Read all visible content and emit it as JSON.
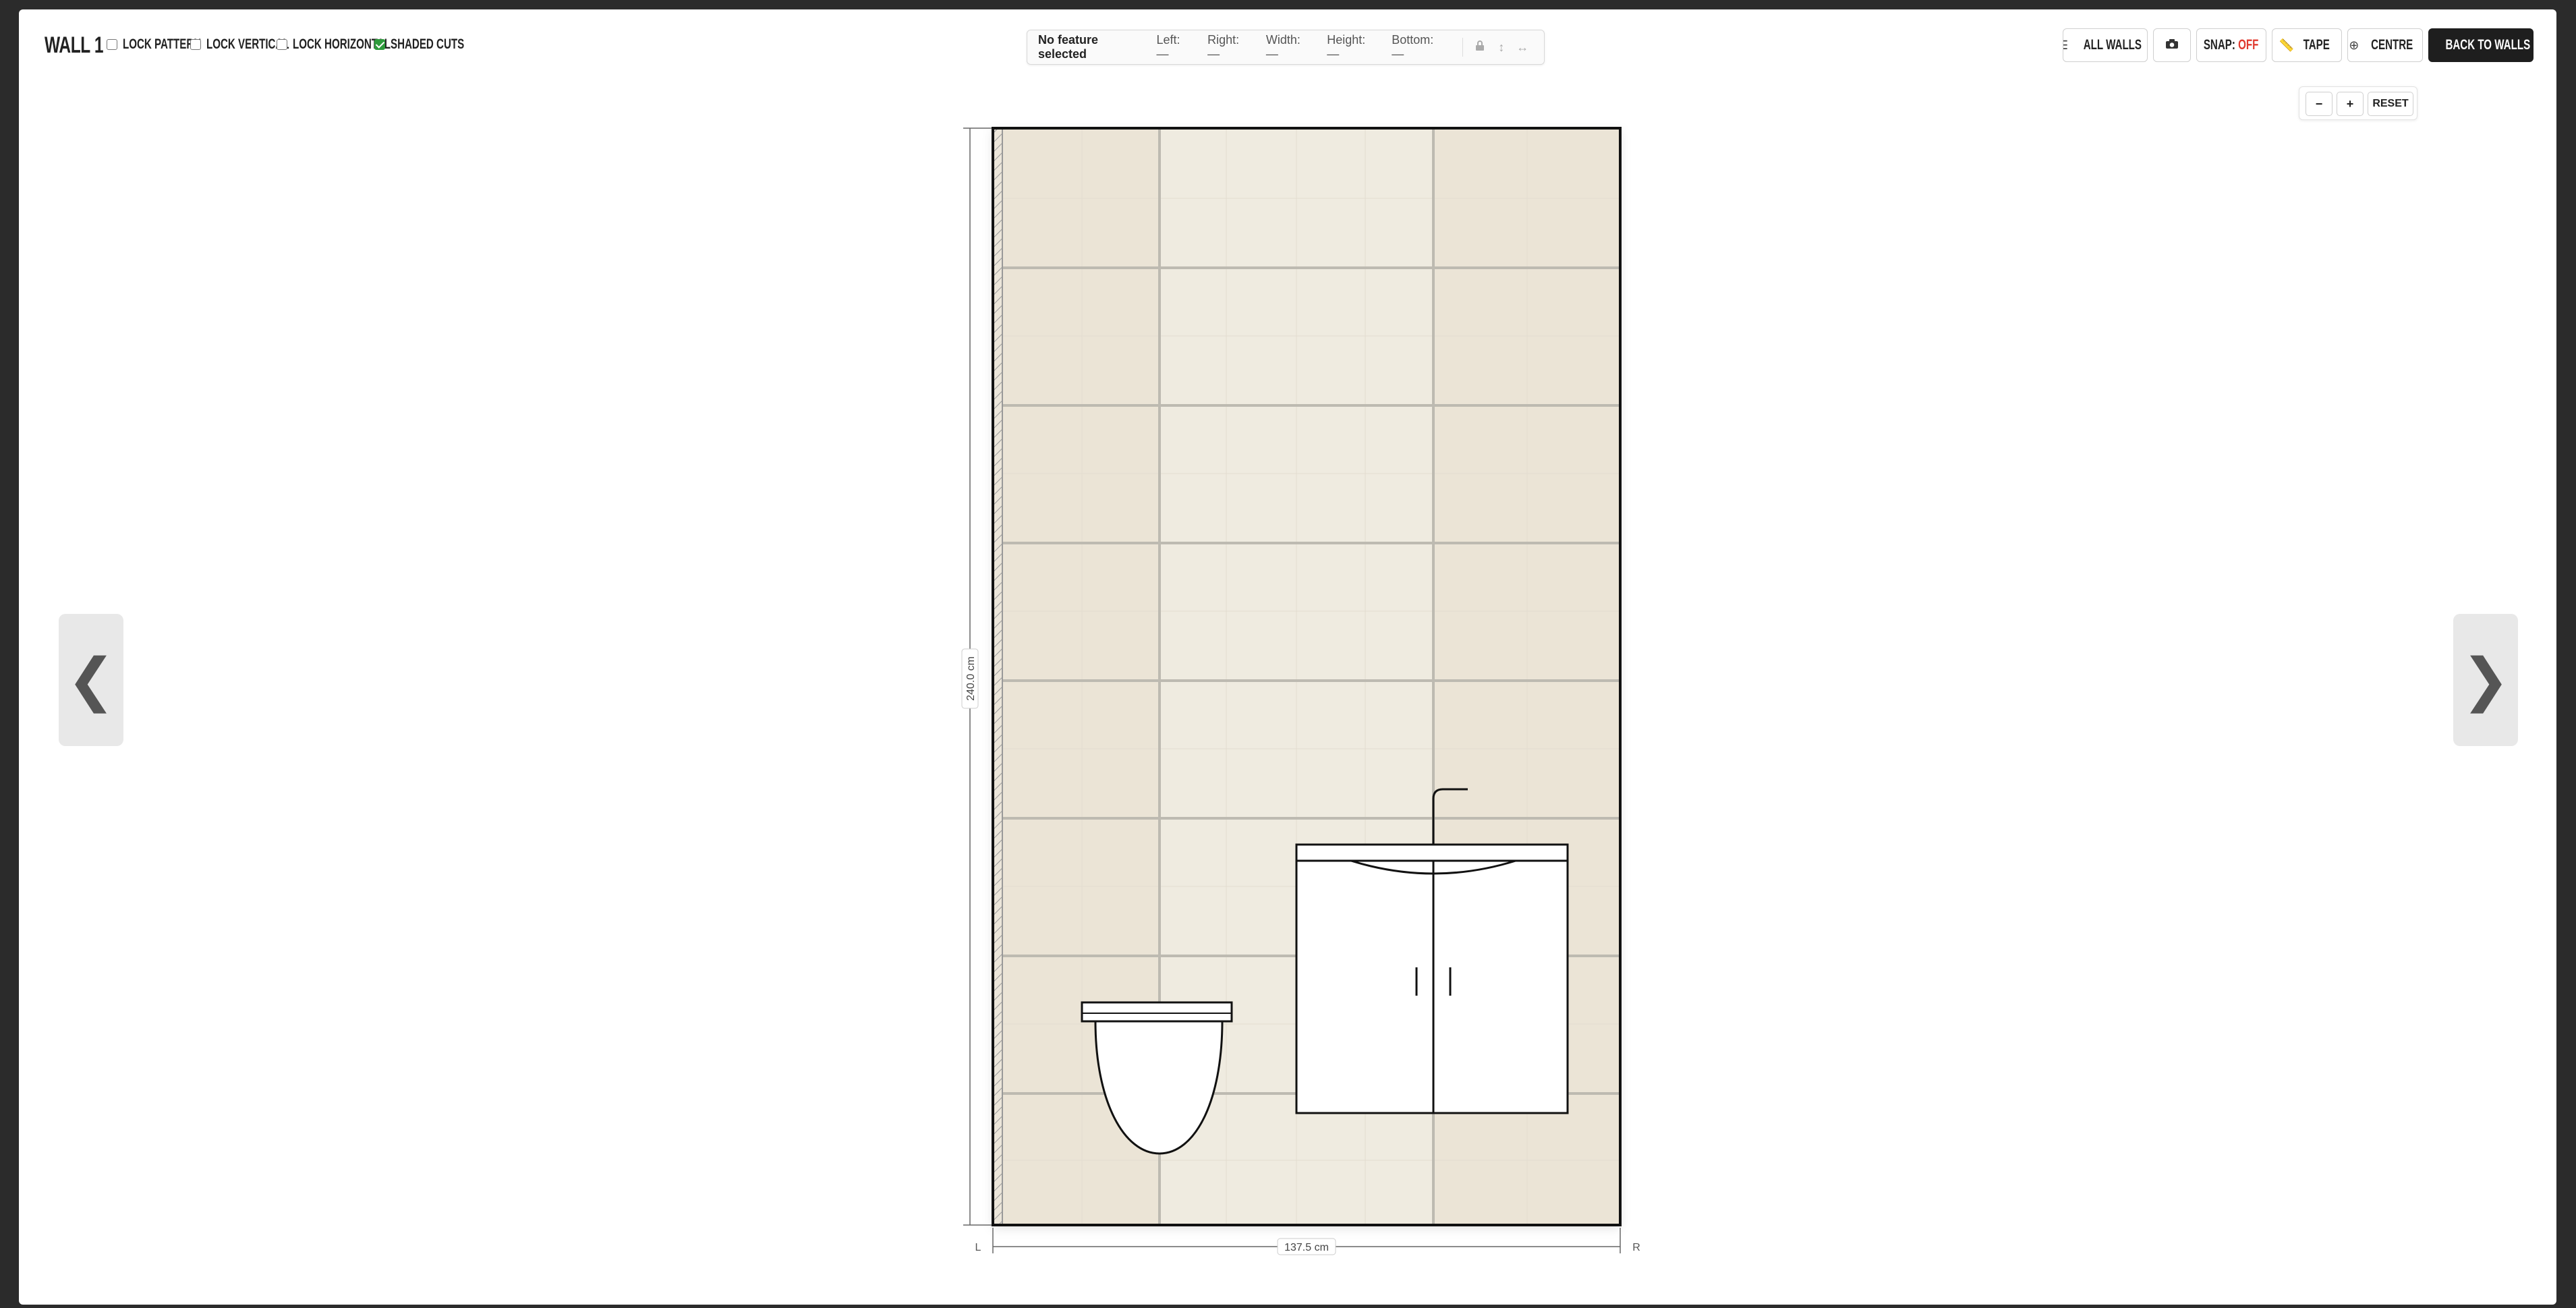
{
  "header": {
    "wall_title": "WALL 1",
    "options": [
      {
        "label": "LOCK PATTERN",
        "checked": false
      },
      {
        "label": "LOCK VERTICAL",
        "checked": false
      },
      {
        "label": "LOCK HORIZONTAL",
        "checked": false
      },
      {
        "label": "SHADED CUTS",
        "checked": true
      }
    ]
  },
  "info": {
    "selection": "No feature selected",
    "left": "Left: —",
    "right": "Right: —",
    "width": "Width: —",
    "height": "Height: —",
    "bottom": "Bottom: —"
  },
  "toolbar": {
    "all_walls": "ALL WALLS",
    "snap_label": "SNAP:",
    "snap_value": "OFF",
    "tape": "TAPE",
    "centre": "CENTRE",
    "back": "BACK TO WALLS"
  },
  "zoom": {
    "minus": "−",
    "plus": "+",
    "reset": "RESET"
  },
  "nav": {
    "prev": "❮",
    "next": "❯"
  },
  "wall": {
    "height_label": "240.0 cm",
    "width_label": "137.5 cm",
    "left_marker": "L",
    "right_marker": "R"
  },
  "colors": {
    "tile_a": "#ece6da",
    "tile_b": "#f0ece1",
    "grout": "#c9c6bd",
    "snap_off": "#e03a2f",
    "check_on": "#2e9b3c"
  }
}
